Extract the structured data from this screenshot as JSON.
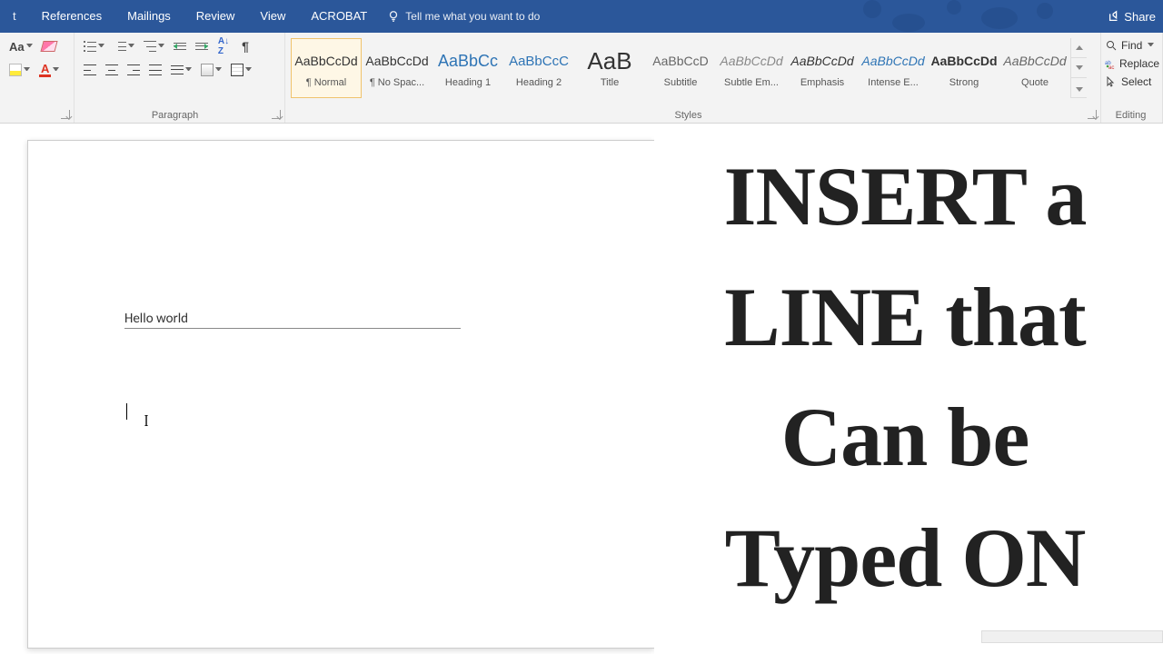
{
  "tabs": [
    "References",
    "Mailings",
    "Review",
    "View",
    "ACROBAT"
  ],
  "tell": "Tell me what you want to do",
  "share": "Share",
  "groups": {
    "font_label": "",
    "paragraph_label": "Paragraph",
    "styles_label": "Styles",
    "editing_label": "Editing"
  },
  "styles": [
    {
      "preview": "AaBbCcDd",
      "name": "¶ Normal",
      "css": "font-size:14px;"
    },
    {
      "preview": "AaBbCcDd",
      "name": "¶ No Spac...",
      "css": "font-size:14px;"
    },
    {
      "preview": "AaBbCc",
      "name": "Heading 1",
      "css": "font-size:18px;color:#2e74b5;"
    },
    {
      "preview": "AaBbCcC",
      "name": "Heading 2",
      "css": "font-size:15px;color:#2e74b5;"
    },
    {
      "preview": "AaB",
      "name": "Title",
      "css": "font-size:26px;"
    },
    {
      "preview": "AaBbCcD",
      "name": "Subtitle",
      "css": "font-size:14px;color:#666;"
    },
    {
      "preview": "AaBbCcDd",
      "name": "Subtle Em...",
      "css": "font-size:14px;font-style:italic;color:#888;"
    },
    {
      "preview": "AaBbCcDd",
      "name": "Emphasis",
      "css": "font-size:14px;font-style:italic;"
    },
    {
      "preview": "AaBbCcDd",
      "name": "Intense E...",
      "css": "font-size:14px;font-style:italic;color:#2e74b5;"
    },
    {
      "preview": "AaBbCcDd",
      "name": "Strong",
      "css": "font-size:14px;font-weight:700;"
    },
    {
      "preview": "AaBbCcDd",
      "name": "Quote",
      "css": "font-size:14px;font-style:italic;color:#666;"
    }
  ],
  "editing": {
    "find": "Find",
    "replace": "Replace",
    "select": "Select"
  },
  "document": {
    "text": "Hello world"
  },
  "overlay": [
    "INSERT a",
    "LINE that",
    "Can be",
    "Typed ON"
  ]
}
